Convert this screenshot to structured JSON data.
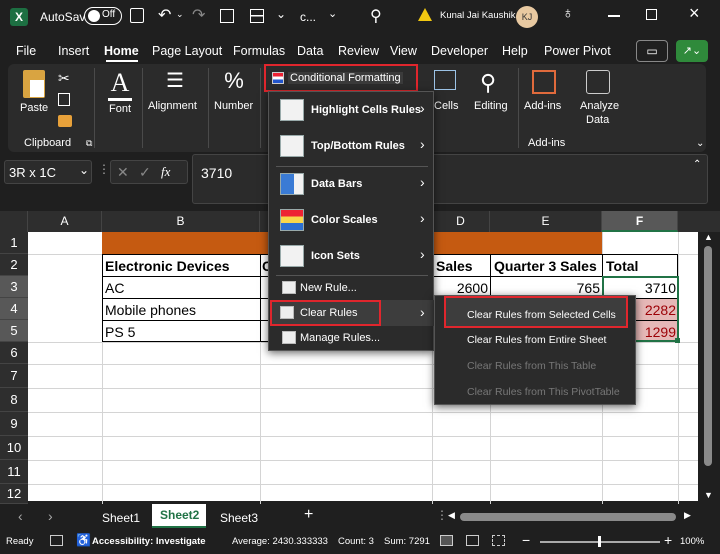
{
  "titlebar": {
    "autosave": "AutoSave",
    "toggle": "Off",
    "filename": "c...",
    "user": "Kunal Jai Kaushik",
    "initials": "KJ"
  },
  "menu": [
    "File",
    "Insert",
    "Home",
    "Page Layout",
    "Formulas",
    "Data",
    "Review",
    "View",
    "Developer",
    "Help",
    "Power Pivot"
  ],
  "ribbon": {
    "paste": "Paste",
    "clipboard": "Clipboard",
    "font": "Font",
    "alignment": "Alignment",
    "number": "Number",
    "cond_fmt": "Conditional Formatting",
    "cells": "Cells",
    "editing": "Editing",
    "addins": "Add-ins",
    "addins_group": "Add-ins",
    "analyze": "Analyze",
    "analyze2": "Data"
  },
  "namebox": "3R x 1C",
  "formula": "3710",
  "fx": "fx",
  "columns": [
    "A",
    "B",
    "C",
    "D",
    "E",
    "F"
  ],
  "rows": [
    "1",
    "2",
    "3",
    "4",
    "5",
    "6",
    "7",
    "8",
    "9",
    "10",
    "11",
    "12"
  ],
  "table": {
    "headers": [
      "Electronic Devices",
      "C",
      "Sales",
      "Quarter 3 Sales",
      "Total"
    ],
    "r3": [
      "AC",
      "2600",
      "765",
      "3710"
    ],
    "r4": [
      "Mobile phones",
      "2282"
    ],
    "r5": [
      "PS 5",
      "1299"
    ]
  },
  "cf_menu": [
    "Highlight Cells Rules",
    "Top/Bottom Rules",
    "Data Bars",
    "Color Scales",
    "Icon Sets",
    "New Rule...",
    "Clear Rules",
    "Manage Rules..."
  ],
  "submenu": [
    "Clear Rules from Selected Cells",
    "Clear Rules from Entire Sheet",
    "Clear Rules from This Table",
    "Clear Rules from This PivotTable"
  ],
  "sheets": [
    "Sheet1",
    "Sheet2",
    "Sheet3"
  ],
  "status": {
    "ready": "Ready",
    "accessibility": "Accessibility: Investigate",
    "average": "Average: 2430.333333",
    "count": "Count: 3",
    "sum": "Sum: 7291",
    "zoom": "100%"
  },
  "colors": {
    "accent": "#c55a11",
    "red": "#e0262d",
    "pinkfill": "#e6b8b7",
    "dark": "#1f1f1f"
  }
}
